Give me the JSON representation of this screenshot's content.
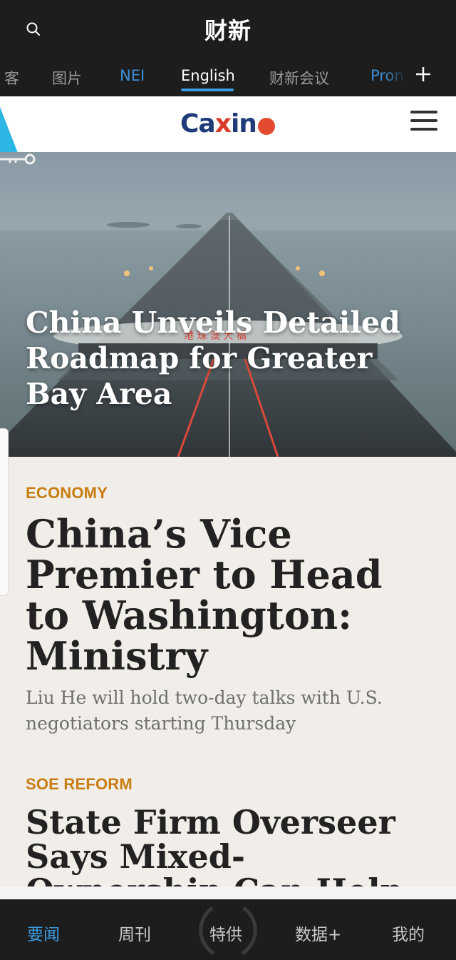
{
  "topbar": {
    "brand": "财新",
    "channels": [
      {
        "label": "客",
        "style": "muted"
      },
      {
        "label": "图片",
        "style": "muted"
      },
      {
        "label": "NEI",
        "style": "blue"
      },
      {
        "label": "English",
        "style": "active"
      },
      {
        "label": "财新会议",
        "style": "muted"
      },
      {
        "label": "Pron",
        "style": "blue"
      }
    ]
  },
  "site": {
    "logo_left": "Ca",
    "logo_x": "x",
    "logo_right": "in"
  },
  "hero": {
    "title": "China Unveils Detailed Roadmap for Greater Bay Area",
    "sign_text": "港 珠 澳 大 橋"
  },
  "articles": [
    {
      "category": "ECONOMY",
      "headline": "China’s Vice Premier to Head to Washington: Ministry",
      "summary": "Liu He will hold two-day talks with U.S. negotiators starting Thursday"
    },
    {
      "category": "SOE REFORM",
      "headline": "State Firm Overseer Says Mixed-Ownership Can Help"
    }
  ],
  "bottom_nav": [
    {
      "label": "要闻",
      "active": true
    },
    {
      "label": "周刊",
      "active": false
    },
    {
      "label": "特供",
      "active": false
    },
    {
      "label": "数据+",
      "active": false
    },
    {
      "label": "我的",
      "active": false
    }
  ],
  "colors": {
    "accent": "#3a9be0",
    "category": "#c87d12",
    "dark_bar": "#1d1d1d",
    "page_bg": "#f1ede8"
  }
}
